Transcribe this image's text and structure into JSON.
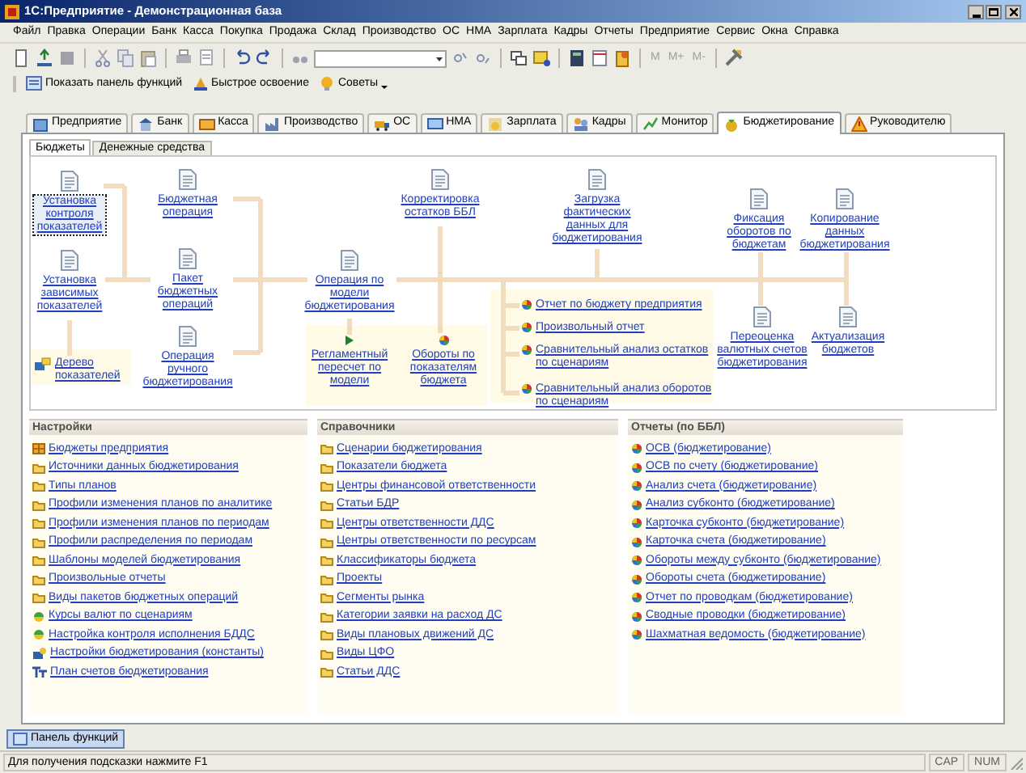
{
  "window": {
    "title": "1С:Предприятие - Демонстрационная база"
  },
  "menu": [
    "Файл",
    "Правка",
    "Операции",
    "Банк",
    "Касса",
    "Покупка",
    "Продажа",
    "Склад",
    "Производство",
    "ОС",
    "НМА",
    "Зарплата",
    "Кадры",
    "Отчеты",
    "Предприятие",
    "Сервис",
    "Окна",
    "Справка"
  ],
  "memory_buttons": [
    {
      "label": "M",
      "disabled": true
    },
    {
      "label": "M+",
      "disabled": true
    },
    {
      "label": "M-",
      "disabled": true
    }
  ],
  "quick_buttons": [
    {
      "label": "Показать панель функций",
      "dropdown": false
    },
    {
      "label": "Быстрое освоение",
      "dropdown": false
    },
    {
      "label": "Советы",
      "dropdown": true
    }
  ],
  "tabs": [
    {
      "label": "Предприятие",
      "selected": false
    },
    {
      "label": "Банк",
      "selected": false
    },
    {
      "label": "Касса",
      "selected": false
    },
    {
      "label": "Производство",
      "selected": false
    },
    {
      "label": "ОС",
      "selected": false
    },
    {
      "label": "НМА",
      "selected": false
    },
    {
      "label": "Зарплата",
      "selected": false
    },
    {
      "label": "Кадры",
      "selected": false
    },
    {
      "label": "Монитор",
      "selected": false
    },
    {
      "label": "Бюджетирование",
      "selected": true
    },
    {
      "label": "Руководителю",
      "selected": false
    }
  ],
  "subtabs": [
    {
      "label": "Бюджеты",
      "selected": true
    },
    {
      "label": "Денежные средства",
      "selected": false
    }
  ],
  "diagram": {
    "nodes": [
      {
        "label": "Установка контроля показателей",
        "kind": "document",
        "selected": true
      },
      {
        "label": "Установка зависимых показателей",
        "kind": "document",
        "selected": false
      },
      {
        "label": "Дерево показателей",
        "kind": "tree",
        "selected": false
      },
      {
        "label": "Бюджетная операция",
        "kind": "document",
        "selected": false
      },
      {
        "label": "Пакет бюджетных операций",
        "kind": "document",
        "selected": false
      },
      {
        "label": "Операция ручного бюджетирования",
        "kind": "document",
        "selected": false
      },
      {
        "label": "Операция по модели бюджетирования",
        "kind": "document",
        "selected": false
      },
      {
        "label": "Регламентный пересчет по модели",
        "kind": "processing",
        "selected": false
      },
      {
        "label": "Корректировка остатков ББЛ",
        "kind": "document",
        "selected": false
      },
      {
        "label": "Обороты по показателям бюджета",
        "kind": "report",
        "selected": false
      },
      {
        "label": "Загрузка фактических данных для бюджетирования",
        "kind": "document",
        "selected": false
      },
      {
        "label": "Фиксация оборотов по бюджетам",
        "kind": "document",
        "selected": false
      },
      {
        "label": "Копирование данных бюджетирования",
        "kind": "document",
        "selected": false
      },
      {
        "label": "Переоценка валютных счетов бюджетирования",
        "kind": "document",
        "selected": false
      },
      {
        "label": "Актуализация бюджетов",
        "kind": "document",
        "selected": false
      }
    ],
    "reports": [
      {
        "label": "Отчет по бюджету предприятия"
      },
      {
        "label": "Произвольный отчет"
      },
      {
        "label": "Сравнительный анализ остатков по сценариям"
      },
      {
        "label": "Сравнительный анализ оборотов по сценариям"
      }
    ]
  },
  "panels": [
    {
      "title": "Настройки",
      "items": [
        {
          "label": "Бюджеты предприятия",
          "kind": "register"
        },
        {
          "label": "Источники данных бюджетирования",
          "kind": "catalog"
        },
        {
          "label": "Типы планов",
          "kind": "catalog"
        },
        {
          "label": "Профили изменения планов по аналитике",
          "kind": "catalog"
        },
        {
          "label": "Профили изменения планов по периодам",
          "kind": "catalog"
        },
        {
          "label": "Профили распределения по периодам",
          "kind": "catalog"
        },
        {
          "label": "Шаблоны моделей бюджетирования",
          "kind": "catalog"
        },
        {
          "label": "Произвольные отчеты",
          "kind": "catalog"
        },
        {
          "label": "Виды пакетов бюджетных операций",
          "kind": "catalog"
        },
        {
          "label": "Курсы валют по сценариям",
          "kind": "info"
        },
        {
          "label": "Настройка контроля исполнения БДДС",
          "kind": "info"
        },
        {
          "label": "Настройки бюджетирования (константы)",
          "kind": "constants"
        },
        {
          "label": "План счетов бюджетирования",
          "kind": "accounts"
        }
      ]
    },
    {
      "title": "Справочники",
      "items": [
        {
          "label": "Сценарии бюджетирования",
          "kind": "catalog"
        },
        {
          "label": "Показатели бюджета",
          "kind": "catalog"
        },
        {
          "label": "Центры финансовой ответственности",
          "kind": "catalog"
        },
        {
          "label": "Статьи БДР",
          "kind": "catalog"
        },
        {
          "label": "Центры ответственности ДДС",
          "kind": "catalog"
        },
        {
          "label": "Центры ответственности по ресурсам",
          "kind": "catalog"
        },
        {
          "label": "Классификаторы бюджета",
          "kind": "catalog"
        },
        {
          "label": "Проекты",
          "kind": "catalog"
        },
        {
          "label": "Сегменты рынка",
          "kind": "catalog"
        },
        {
          "label": "Категории заявки на расход ДС",
          "kind": "catalog"
        },
        {
          "label": "Виды плановых движений ДС",
          "kind": "catalog"
        },
        {
          "label": "Виды ЦФО",
          "kind": "catalog"
        },
        {
          "label": "Статьи ДДС",
          "kind": "catalog"
        }
      ]
    },
    {
      "title": "Отчеты (по ББЛ)",
      "items": [
        {
          "label": "ОСВ (бюджетирование)",
          "kind": "report"
        },
        {
          "label": "ОСВ по счету (бюджетирование)",
          "kind": "report"
        },
        {
          "label": "Анализ счета (бюджетирование)",
          "kind": "report"
        },
        {
          "label": "Анализ субконто (бюджетирование)",
          "kind": "report"
        },
        {
          "label": "Карточка субконто (бюджетирование)",
          "kind": "report"
        },
        {
          "label": "Карточка счета (бюджетирование)",
          "kind": "report"
        },
        {
          "label": "Обороты между субконто (бюджетирование)",
          "kind": "report"
        },
        {
          "label": "Обороты счета (бюджетирование)",
          "kind": "report"
        },
        {
          "label": "Отчет по проводкам (бюджетирование)",
          "kind": "report"
        },
        {
          "label": "Сводные проводки (бюджетирование)",
          "kind": "report"
        },
        {
          "label": "Шахматная ведомость (бюджетирование)",
          "kind": "report"
        }
      ]
    }
  ],
  "taskbar": {
    "label": "Панель функций",
    "selected": true
  },
  "status_bar": {
    "hint": "Для получения подсказки нажмите F1",
    "indicators": [
      "CAP",
      "NUM"
    ]
  }
}
